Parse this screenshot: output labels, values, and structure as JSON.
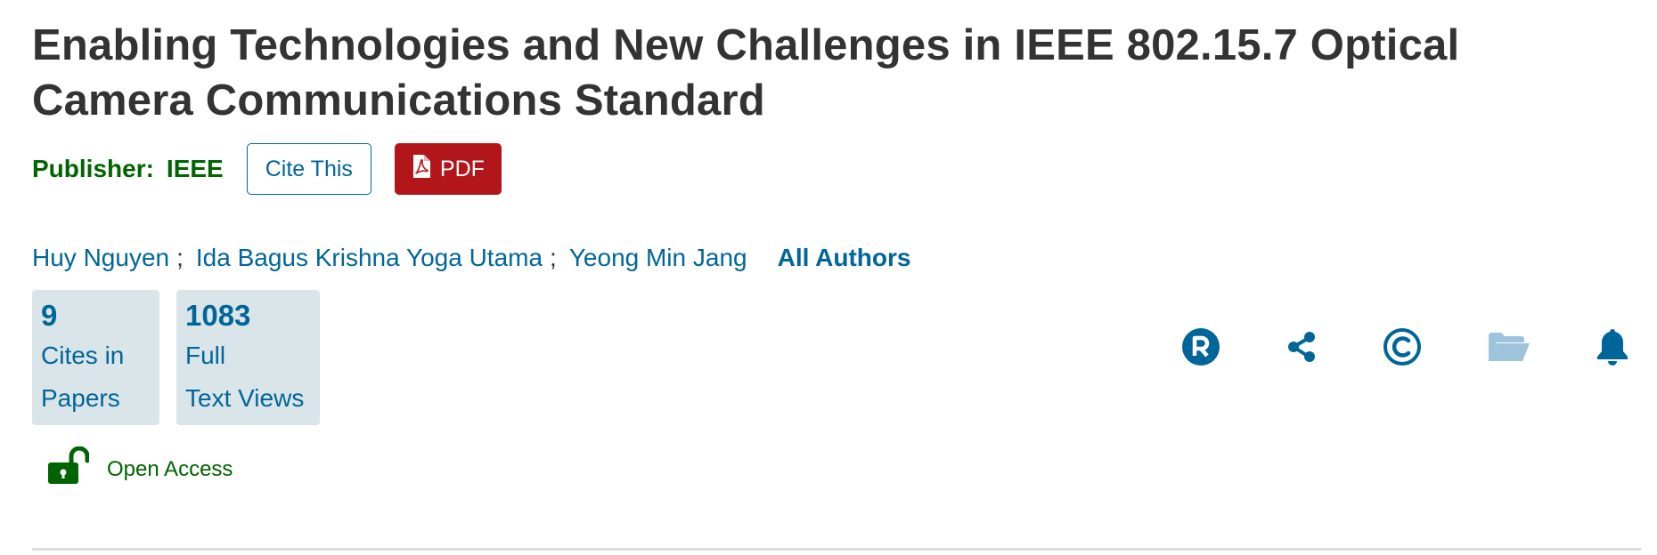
{
  "article": {
    "title_line1": "Enabling Technologies and New Challenges in IEEE 802.15.7 Optical",
    "title_line2": "Camera Communications Standard",
    "publisher_label": "Publisher:",
    "publisher_name": "IEEE",
    "cite_label": "Cite This",
    "pdf_label": "PDF"
  },
  "authors": {
    "list": [
      "Huy Nguyen",
      "Ida Bagus Krishna Yoga Utama",
      "Yeong Min Jang"
    ],
    "separator": ";",
    "all_label": "All Authors"
  },
  "metrics": [
    {
      "value": "9",
      "label_line1": "Cites in",
      "label_line2": "Papers"
    },
    {
      "value": "1083",
      "label_line1": "Full",
      "label_line2": "Text Views"
    }
  ],
  "access": {
    "label": "Open Access"
  },
  "toolbar_icons": [
    "rights-icon",
    "share-icon",
    "copyright-icon",
    "folder-icon",
    "alert-bell-icon"
  ],
  "colors": {
    "title": "#333333",
    "publisher_green": "#006400",
    "link_blue": "#006699",
    "pdf_red": "#b3161a",
    "metric_bg": "#dae5ea",
    "folder_light": "#9ec4dc"
  }
}
